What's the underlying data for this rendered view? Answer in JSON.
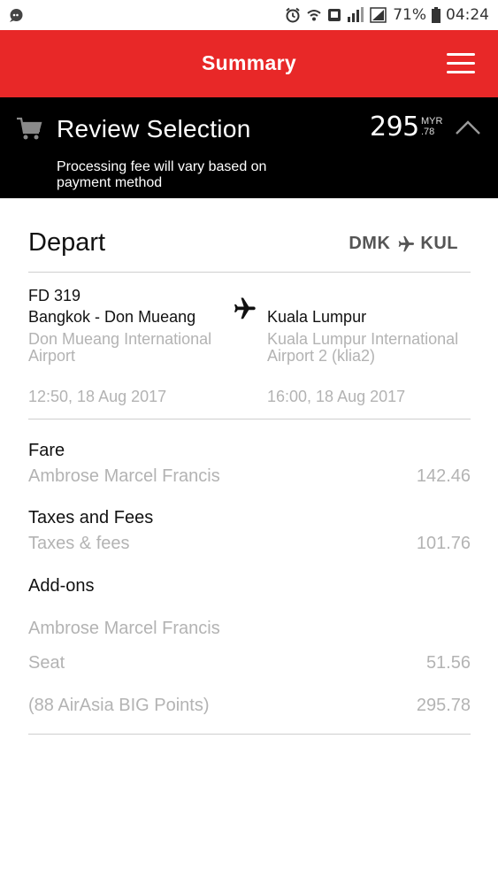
{
  "status_bar": {
    "battery_percent": "71%",
    "time": "04:24",
    "icons": [
      "notification-bubble-icon",
      "alarm-icon",
      "wifi-icon",
      "screen-record-icon",
      "cellular-icon",
      "signal-icon",
      "battery-icon"
    ]
  },
  "header": {
    "title": "Summary",
    "menu_icon": "hamburger-menu-icon"
  },
  "review": {
    "title": "Review Selection",
    "price_whole": "295",
    "currency": "MYR",
    "price_cents": ".78",
    "note": "Processing fee will vary based on payment method",
    "cart_icon": "cart-icon",
    "collapse_icon": "chevron-up-icon"
  },
  "depart": {
    "title": "Depart",
    "origin_code": "DMK",
    "destination_code": "KUL",
    "flight_number": "FD 319",
    "origin_city": "Bangkok - Don Mueang",
    "origin_airport": "Don Mueang International Airport",
    "destination_city": "Kuala Lumpur",
    "destination_airport": "Kuala Lumpur International Airport 2 (klia2)",
    "departure_time": "12:50, 18 Aug 2017",
    "arrival_time": "16:00, 18 Aug 2017"
  },
  "breakdown": {
    "fare_label": "Fare",
    "fare_name": "Ambrose Marcel Francis",
    "fare_amount": "142.46",
    "taxes_label": "Taxes and Fees",
    "taxes_name": "Taxes & fees",
    "taxes_amount": "101.76",
    "addons_label": "Add-ons",
    "addon_passenger": "Ambrose Marcel Francis",
    "seat_label": "Seat",
    "seat_amount": "51.56",
    "points_label": "(88 AirAsia BIG Points)",
    "total_amount": "295.78"
  },
  "colors": {
    "brand_red": "#e82828",
    "review_bar": "#000000",
    "muted_text": "#b3b3b3"
  }
}
